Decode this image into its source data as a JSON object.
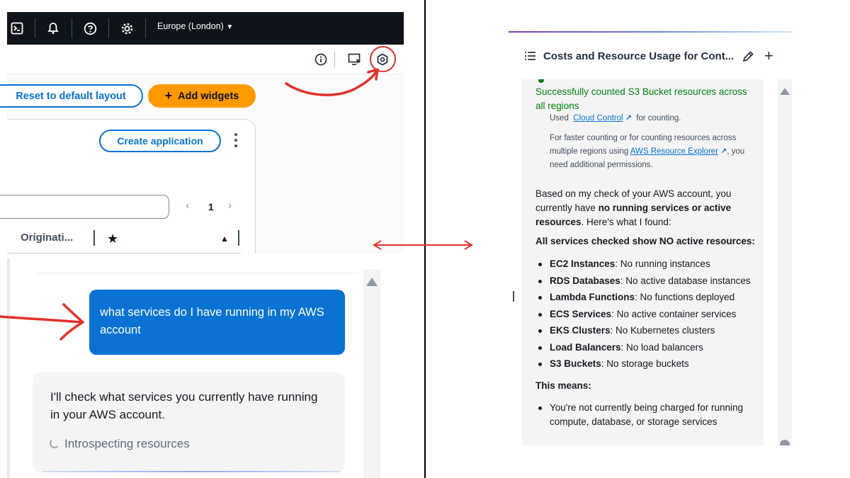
{
  "console": {
    "region": "Europe (London)",
    "icons": [
      "cloudshell-icon",
      "bell-icon",
      "help-icon",
      "settings-icon"
    ]
  },
  "dashboard": {
    "reset_button": "Reset to default layout",
    "add_widgets_button": "Add widgets",
    "add_widgets_plus": "+",
    "create_application_button": "Create application",
    "page_number": "1",
    "column_header": "Originati..."
  },
  "chat_left": {
    "user_message": "what services do I have running in my AWS account",
    "assistant_message": "I'll check what services you currently have running in your AWS account.",
    "loading_text": "Introspecting resources"
  },
  "chat_right": {
    "title": "Costs and Resource Usage for Cont...",
    "success_text": "Successfully counted S3 Bucket resources across all regions",
    "used_prefix": "Used",
    "cloud_control_link": "Cloud Control",
    "used_suffix": "for counting.",
    "faster_text_1": "For faster counting or for counting resources across multiple regions using",
    "resource_explorer_link": "AWS Resource Explorer",
    "faster_text_2": ", you need additional permissions.",
    "summary_1": "Based on my check of your AWS account, you currently have",
    "summary_bold": "no running services or active resources",
    "summary_2": ". Here's what I found:",
    "heading_1": "All services checked show NO active resources:",
    "services": [
      {
        "name": "EC2 Instances",
        "status": ": No running instances"
      },
      {
        "name": "RDS Databases",
        "status": ": No active database instances"
      },
      {
        "name": "Lambda Functions",
        "status": ": No functions deployed"
      },
      {
        "name": "ECS Services",
        "status": ": No active container services"
      },
      {
        "name": "EKS Clusters",
        "status": ": No Kubernetes clusters"
      },
      {
        "name": "Load Balancers",
        "status": ": No load balancers"
      },
      {
        "name": "S3 Buckets",
        "status": ": No storage buckets"
      }
    ],
    "heading_2": "This means:",
    "means": [
      "You're not currently being charged for running compute, database, or storage services"
    ]
  },
  "colors": {
    "accent_blue": "#0972d3",
    "add_widgets_orange": "#ff9900",
    "annotation_red": "#e0322b",
    "success_green": "#037f0c",
    "topbar_bg": "#0f141a"
  }
}
